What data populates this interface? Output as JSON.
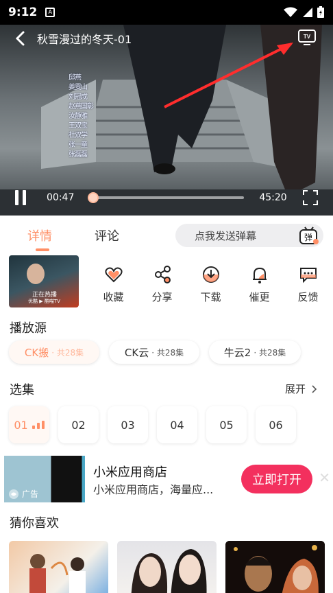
{
  "status": {
    "time": "9:12"
  },
  "player": {
    "title": "秋雪漫过的冬天-01",
    "current_time": "00:47",
    "total_time": "45:20",
    "progress": 0.017,
    "credits": [
      "邱燕",
      "姜雯山",
      "刘冠成",
      "赵燕国彰",
      "汝静雅",
      "王双宝",
      "杜双学",
      "张一童",
      "张磊磊"
    ]
  },
  "tabs": {
    "details": "详情",
    "comments": "评论"
  },
  "danmu": {
    "placeholder": "点我发送弹幕",
    "icon_label": "弹"
  },
  "poster": {
    "hot_text": "正在热播",
    "sub_text": "优酷 ▶ 酷喵TV"
  },
  "actions": [
    {
      "label": "收藏",
      "icon": "heart-icon"
    },
    {
      "label": "分享",
      "icon": "share-icon"
    },
    {
      "label": "下载",
      "icon": "download-icon"
    },
    {
      "label": "催更",
      "icon": "bell-icon"
    },
    {
      "label": "反馈",
      "icon": "feedback-icon"
    }
  ],
  "sources": {
    "title": "播放源",
    "items": [
      {
        "name": "CK搬",
        "count": "· 共28集"
      },
      {
        "name": "CK云",
        "count": "· 共28集"
      },
      {
        "name": "牛云2",
        "count": "· 共28集"
      }
    ]
  },
  "episodes": {
    "title": "选集",
    "expand": "展开",
    "items": [
      "01",
      "02",
      "03",
      "04",
      "05",
      "06"
    ]
  },
  "ad": {
    "tag": "广告",
    "title": "小米应用商店",
    "desc": "小米应用商店，海量应...",
    "button": "立即打开",
    "close": "✕"
  },
  "recommend": {
    "title": "猜你喜欢"
  },
  "colors": {
    "accent": "#ff8f66",
    "ad_button": "#f3305e"
  }
}
